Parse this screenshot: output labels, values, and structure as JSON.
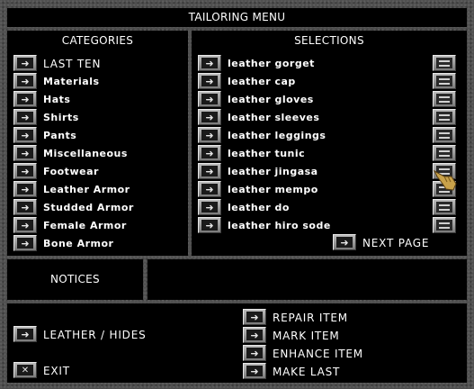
{
  "window": {
    "title": "TAILORING MENU"
  },
  "categories": {
    "title": "CATEGORIES",
    "items": [
      "LAST TEN",
      "Materials",
      "Hats",
      "Shirts",
      "Pants",
      "Miscellaneous",
      "Footwear",
      "Leather Armor",
      "Studded Armor",
      "Female Armor",
      "Bone Armor"
    ]
  },
  "selections": {
    "title": "SELECTIONS",
    "items": [
      "leather gorget",
      "leather cap",
      "leather gloves",
      "leather sleeves",
      "leather leggings",
      "leather tunic",
      "leather jingasa",
      "leather mempo",
      "leather do",
      "leather hiro sode"
    ],
    "next_page": "NEXT PAGE"
  },
  "notices": {
    "title": "NOTICES",
    "text": ""
  },
  "bottom": {
    "material": "LEATHER / HIDES",
    "exit": "EXIT",
    "repair": "REPAIR ITEM",
    "mark": "MARK ITEM",
    "enhance": "ENHANCE ITEM",
    "make_last": "MAKE LAST"
  },
  "icons": {
    "select": "arrow-right-icon",
    "info": "info-gump-icon",
    "exit": "x-close-icon",
    "cursor": "gauntlet-cursor-icon"
  },
  "colors": {
    "background": "#4f4f4f",
    "panel": "#000000",
    "button": "#a0a0a0",
    "text": "#ffffff"
  }
}
